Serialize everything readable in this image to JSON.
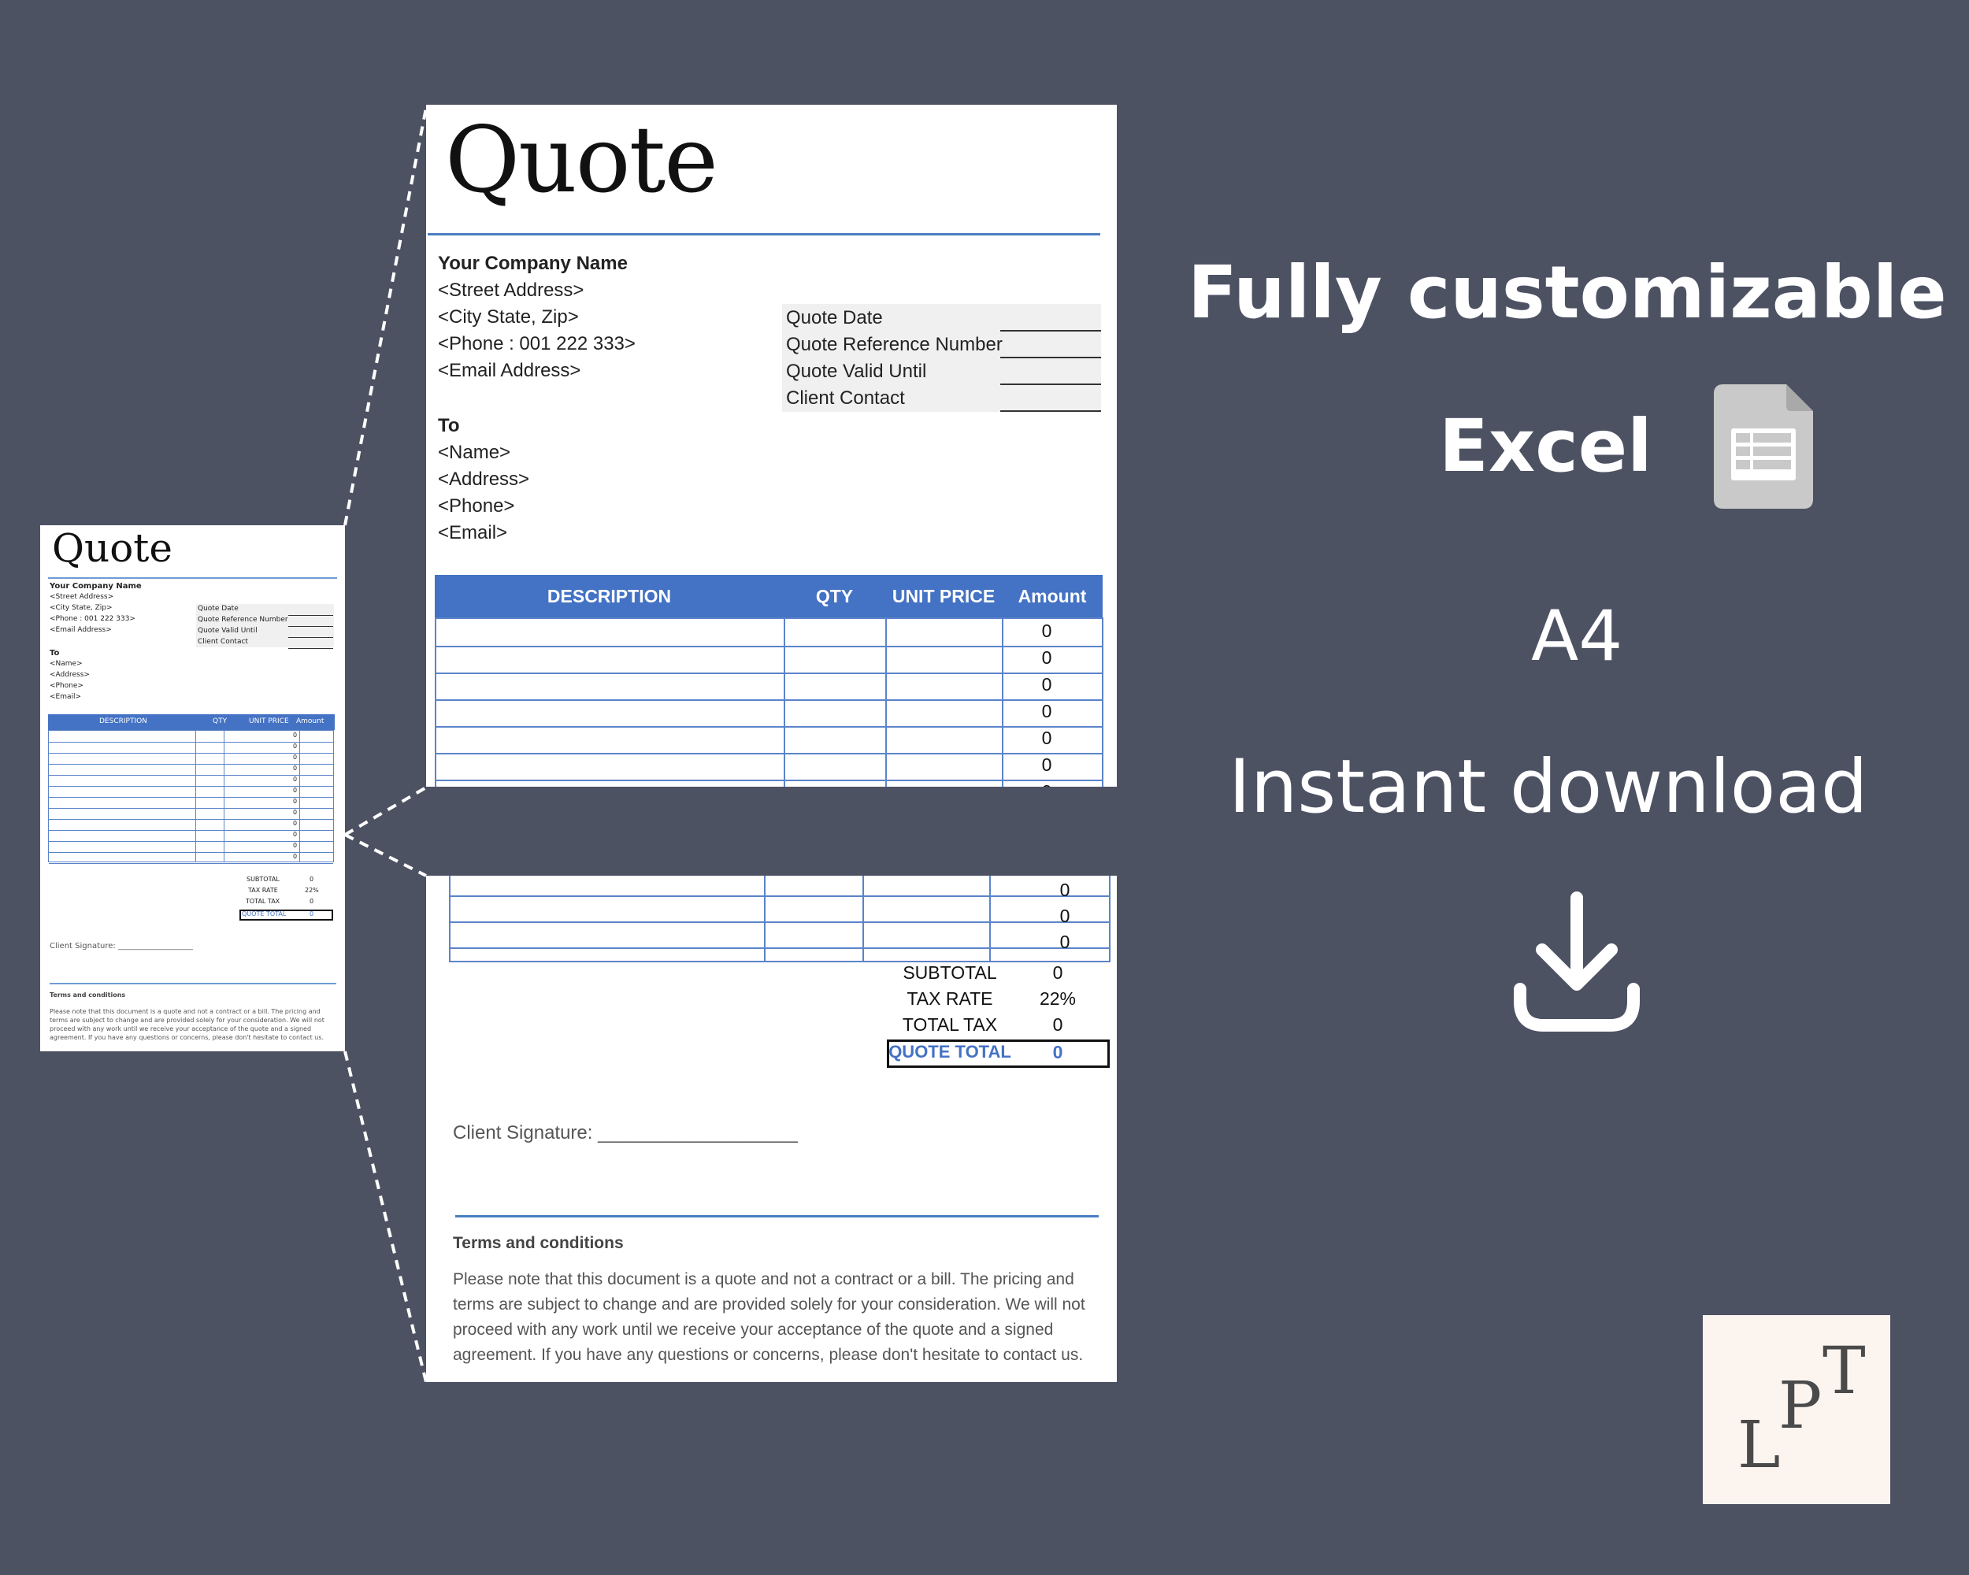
{
  "quote": {
    "title": "Quote",
    "company": {
      "name": "Your Company Name",
      "street": "<Street Address>",
      "city": "<City State, Zip>",
      "phone": "<Phone : 001 222 333>",
      "email": "<Email Address>"
    },
    "meta_labels": [
      "Quote Date",
      "Quote Reference Number",
      "Quote Valid Until",
      "Client Contact"
    ],
    "to": {
      "label": "To",
      "name": "<Name>",
      "address": "<Address>",
      "phone": "<Phone>",
      "email": "<Email>"
    },
    "table_headers": [
      "DESCRIPTION",
      "QTY",
      "UNIT PRICE",
      "Amount"
    ],
    "row_amount": "0",
    "totals": {
      "subtotal_label": "SUBTOTAL",
      "subtotal_value": "0",
      "tax_rate_label": "TAX RATE",
      "tax_rate_value": "22%",
      "total_tax_label": "TOTAL TAX",
      "total_tax_value": "0",
      "quote_total_label": "QUOTE TOTAL",
      "quote_total_value": "0"
    },
    "signature_label": "Client Signature: ___________________",
    "terms_title": "Terms and conditions",
    "terms_text": "Please note that this document is a quote and not a contract or a bill. The pricing and terms are subject to change and are provided solely for your consideration. We will not proceed with any work until we receive your acceptance of the quote and a signed agreement. If you have any questions or concerns, please don't hesitate to contact us."
  },
  "features": {
    "customizable": "Fully customizable",
    "excel": "Excel",
    "a4": "A4",
    "instant": "Instant download"
  },
  "logo": {
    "l": "L",
    "p": "P",
    "t": "T"
  },
  "colors": {
    "background": "#4d5263",
    "table_header": "#4472c4",
    "quote_total": "#4472c4",
    "logo_bg": "#fcf4ef"
  }
}
